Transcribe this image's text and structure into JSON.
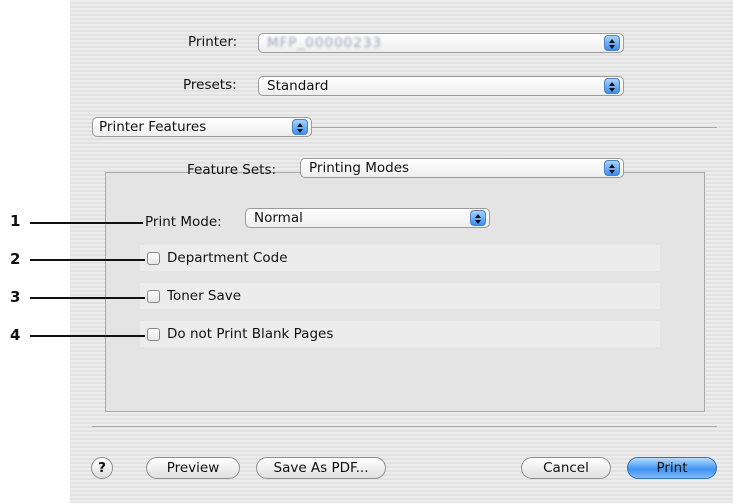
{
  "printer": {
    "label": "Printer:",
    "value": "MFP_00000233"
  },
  "presets": {
    "label": "Presets:",
    "value": "Standard"
  },
  "pane_menu": {
    "value": "Printer Features"
  },
  "feature_sets": {
    "label": "Feature Sets:",
    "value": "Printing Modes"
  },
  "options": {
    "print_mode": {
      "label": "Print Mode:",
      "value": "Normal"
    },
    "department_code": {
      "label": "Department Code",
      "checked": false
    },
    "toner_save": {
      "label": "Toner Save",
      "checked": false
    },
    "blank_pages": {
      "label": "Do not Print Blank Pages",
      "checked": false
    }
  },
  "callouts": [
    "1",
    "2",
    "3",
    "4"
  ],
  "buttons": {
    "help": "?",
    "preview": "Preview",
    "save_as_pdf": "Save As PDF...",
    "cancel": "Cancel",
    "print": "Print"
  },
  "colors": {
    "accent": "#3f94f2",
    "stripe_light": "#ececec",
    "stripe_dark": "#e2e2e2"
  }
}
